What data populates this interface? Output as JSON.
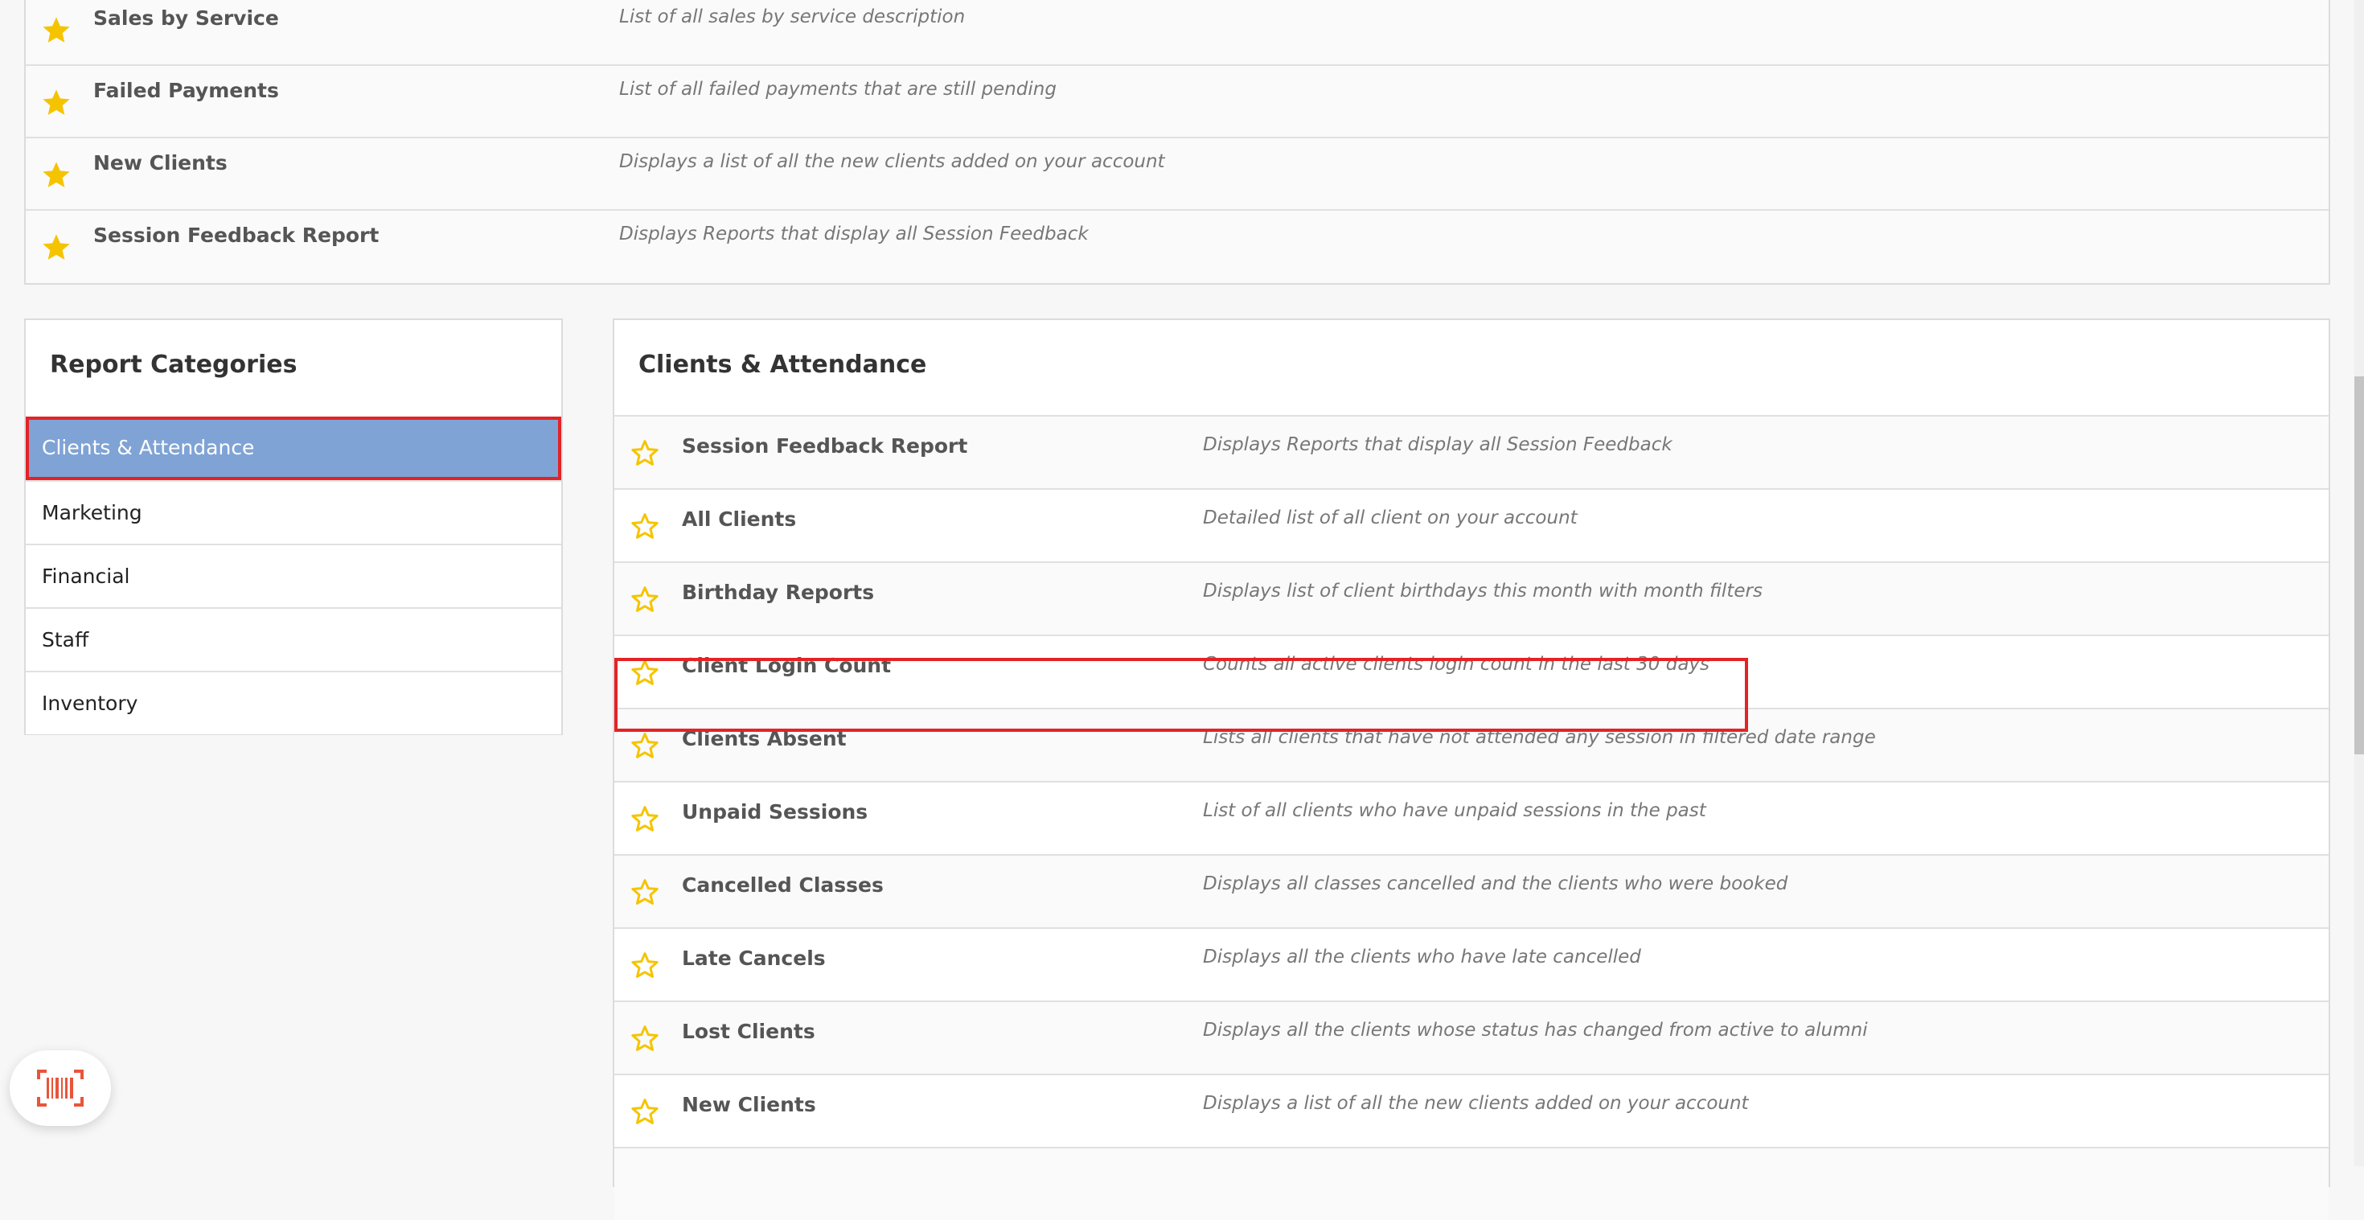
{
  "favourites": [
    {
      "title": "Sales by Service",
      "desc": "List of all sales by service description"
    },
    {
      "title": "Failed Payments",
      "desc": "List of all failed payments that are still pending"
    },
    {
      "title": "New Clients",
      "desc": "Displays a list of all the new clients added on your account"
    },
    {
      "title": "Session Feedback Report",
      "desc": "Displays Reports that display all Session Feedback"
    }
  ],
  "categories": {
    "title": "Report Categories",
    "items": [
      {
        "label": "Clients & Attendance"
      },
      {
        "label": "Marketing"
      },
      {
        "label": "Financial"
      },
      {
        "label": "Staff"
      },
      {
        "label": "Inventory"
      }
    ],
    "active": "Clients & Attendance"
  },
  "reports": {
    "title": "Clients & Attendance",
    "items": [
      {
        "title": "Session Feedback Report",
        "desc": "Displays Reports that display all Session Feedback"
      },
      {
        "title": "All Clients",
        "desc": "Detailed list of all client on your account"
      },
      {
        "title": "Birthday Reports",
        "desc": "Displays list of client birthdays this month with month filters"
      },
      {
        "title": "Client Login Count",
        "desc": "Counts all active clients login count in the last 30 days"
      },
      {
        "title": "Clients Absent",
        "desc": "Lists all clients that have not attended any session in filtered date range"
      },
      {
        "title": "Unpaid Sessions",
        "desc": "List of all clients who have unpaid sessions in the past"
      },
      {
        "title": "Cancelled Classes",
        "desc": "Displays all classes cancelled and the clients who were booked"
      },
      {
        "title": "Late Cancels",
        "desc": "Displays all the clients who have late cancelled"
      },
      {
        "title": "Lost Clients",
        "desc": "Displays all the clients whose status has changed from active to alumni"
      },
      {
        "title": "New Clients",
        "desc": "Displays a list of all the new clients added on your account"
      }
    ]
  },
  "icons": {
    "favourite_filled": "star-filled-icon",
    "favourite_outline": "star-outline-icon",
    "widget": "barcode-scanner-icon"
  },
  "colors": {
    "star": "#f5c400",
    "active_category_bg": "#7fa3d5",
    "highlight_border": "#e32326",
    "widget_icon": "#e8553a"
  }
}
